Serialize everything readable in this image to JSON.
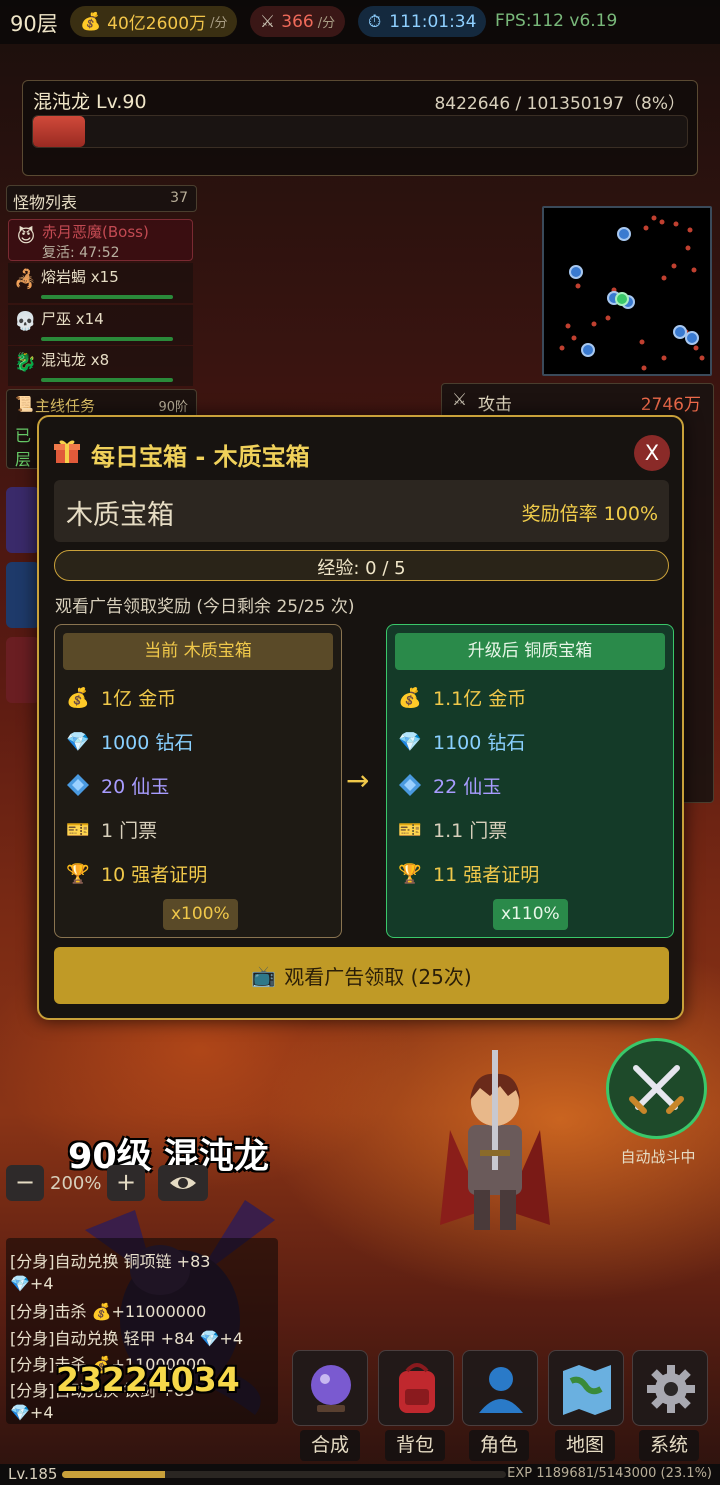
{
  "topbar": {
    "floor": "90层",
    "gold": "40亿2600万",
    "gold_unit": "/分",
    "atk": "366",
    "atk_unit": "/分",
    "timer": "111:01:34",
    "fps": "FPS:112 v6.19"
  },
  "boss": {
    "name": "混沌龙 Lv.90",
    "hp_text": "8422646 / 101350197（8%）",
    "hp_fraction": 0.08
  },
  "monsters": {
    "header": "怪物列表",
    "count": "37",
    "boss_row": {
      "name": "赤月恶魔(Boss)",
      "respawn": "复活: 47:52",
      "icon": "demon-icon"
    },
    "rows": [
      {
        "name": "熔岩蝎 x15",
        "icon": "scorpion-icon"
      },
      {
        "name": "尸巫 x14",
        "icon": "skull-icon"
      },
      {
        "name": "混沌龙 x8",
        "icon": "dragon-icon"
      }
    ]
  },
  "quest": {
    "title": "主线任务",
    "level": "90阶",
    "line1": "已",
    "line2": "层"
  },
  "stats": {
    "label": "攻击",
    "value": "2746万"
  },
  "modal": {
    "title": "每日宝箱 - 木质宝箱",
    "close": "X",
    "chest_name": "木质宝箱",
    "rate": "奖励倍率 100%",
    "exp": "经验: 0 / 5",
    "ad_note": "观看广告领取奖励 (今日剩余 25/25 次)",
    "current": {
      "header": "当前 木质宝箱",
      "rewards": [
        {
          "icon": "money-bag-icon",
          "text": "1亿 金币",
          "color": "gold"
        },
        {
          "icon": "diamond-icon",
          "text": "1000 钻石",
          "color": "dia"
        },
        {
          "icon": "jade-icon",
          "text": "20 仙玉",
          "color": "jade"
        },
        {
          "icon": "ticket-icon",
          "text": "1 门票",
          "color": "tick"
        },
        {
          "icon": "trophy-icon",
          "text": "10 强者证明",
          "color": "cert"
        }
      ],
      "multiplier": "x100%"
    },
    "upgraded": {
      "header": "升级后 铜质宝箱",
      "rewards": [
        {
          "icon": "money-bag-icon",
          "text": "1.1亿 金币",
          "color": "gold"
        },
        {
          "icon": "diamond-icon",
          "text": "1100 钻石",
          "color": "dia"
        },
        {
          "icon": "jade-icon",
          "text": "22 仙玉",
          "color": "jade"
        },
        {
          "icon": "ticket-icon",
          "text": "1.1 门票",
          "color": "tick"
        },
        {
          "icon": "trophy-icon",
          "text": "11 强者证明",
          "color": "cert"
        }
      ],
      "multiplier": "x110%"
    },
    "arrow": "→",
    "ad_button": "观看广告领取 (25次)"
  },
  "battle": {
    "boss_label": "90级 混沌龙",
    "zoom": "200%",
    "zoom_minus": "−",
    "zoom_plus": "+",
    "damage": "23224034",
    "auto_label": "自动战斗中"
  },
  "log": [
    "[分身]自动兑换 铜项链 +83",
    "💎+4",
    "[分身]击杀 💰+11000000",
    "[分身]自动兑换 轻甲 +84 💎+4",
    "[分身]击杀 💰+11000000",
    "[分身]自动兑换 铁剑 +83",
    "💎+4"
  ],
  "nav": [
    {
      "label": "合成",
      "icon": "crystal-ball-icon"
    },
    {
      "label": "背包",
      "icon": "backpack-icon"
    },
    {
      "label": "角色",
      "icon": "person-icon"
    },
    {
      "label": "地图",
      "icon": "map-icon"
    },
    {
      "label": "系统",
      "icon": "gear-icon"
    }
  ],
  "exp": {
    "level": "Lv.185",
    "text": "EXP 1189681/5143000 (23.1%)",
    "fraction": 0.231
  },
  "colors": {
    "accent": "#c9a13a",
    "upgrade": "#3ac86a",
    "hp": "#c0392b"
  }
}
